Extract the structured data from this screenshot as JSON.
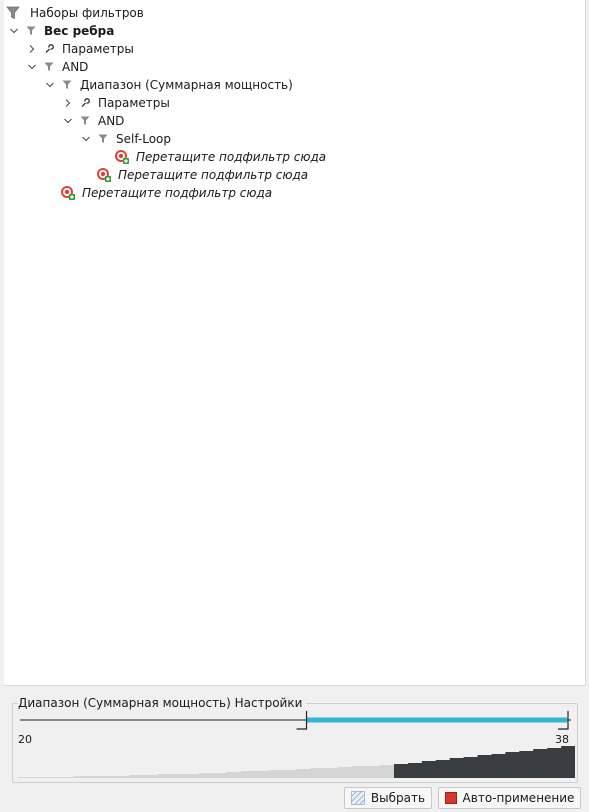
{
  "tree": {
    "root_label": "Наборы фильтров",
    "edge_weight_label": "Вес ребра",
    "params_label": "Параметры",
    "and_label": "AND",
    "range_label": "Диапазон (Суммарная мощность)",
    "range_params_label": "Параметры",
    "range_and_label": "AND",
    "selfloop_label": "Self-Loop",
    "drop_selfloop": "Перетащите подфильтр сюда",
    "drop_and": "Перетащите подфильтр сюда",
    "drop_root": "Перетащите подфильтр сюда"
  },
  "settings": {
    "title": "Диапазон (Суммарная мощность) Настройки",
    "min_label": "20",
    "max_label": "38",
    "range_low": 20,
    "range_high": 38,
    "selected_low_fraction": 0.52,
    "selected_high_fraction": 1.0
  },
  "buttons": {
    "select_label": "Выбрать",
    "auto_apply_label": "Авто-применение"
  },
  "colors": {
    "slider_accent": "#33b5d6",
    "histogram_selected": "#3a3d40",
    "histogram_unselected": "#d4d6d6",
    "target_red": "#e0403a",
    "plus_green": "#2c9a2c",
    "stop_red": "#d8372b"
  }
}
